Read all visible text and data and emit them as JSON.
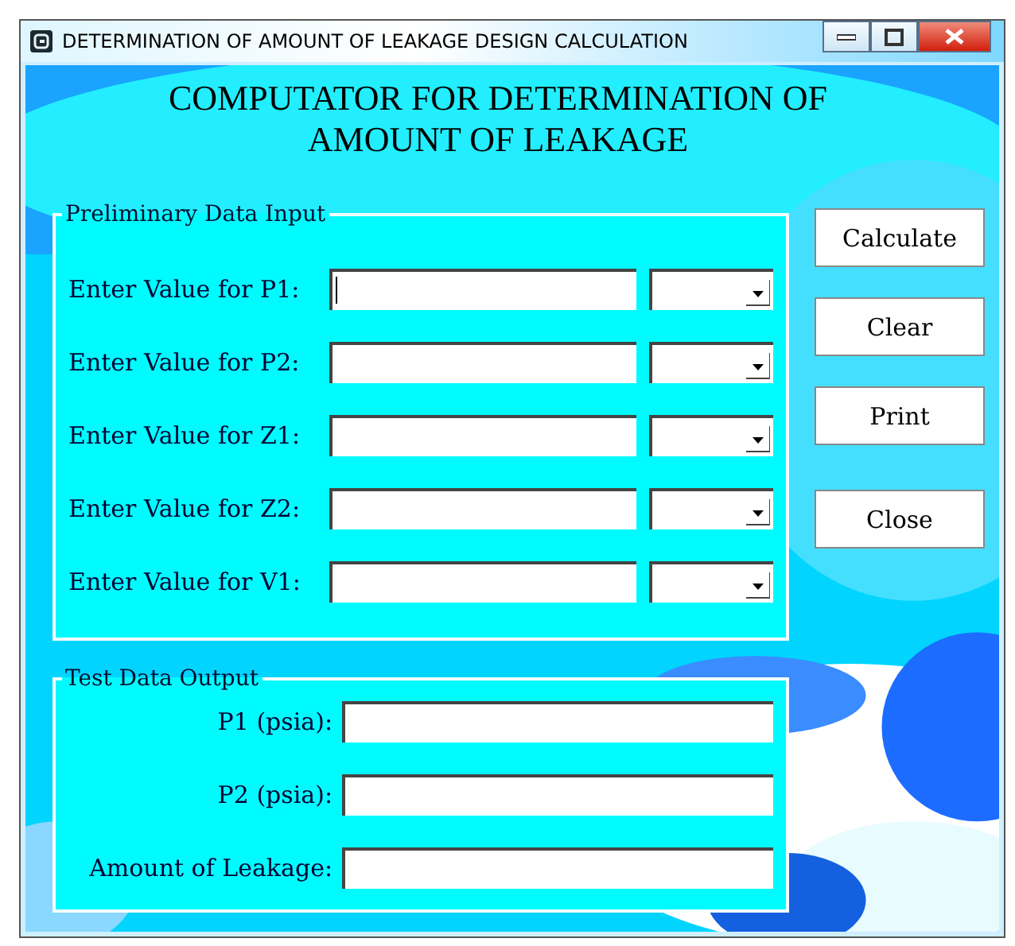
{
  "window": {
    "title": "DETERMINATION OF AMOUNT OF LEAKAGE DESIGN CALCULATION"
  },
  "heading": [
    "COMPUTATOR FOR DETERMINATION OF",
    "AMOUNT OF LEAKAGE"
  ],
  "input_group": {
    "title": "Preliminary Data Input",
    "rows": [
      {
        "label": "Enter Value for P1:",
        "focused": true
      },
      {
        "label": "Enter Value for P2:",
        "focused": false
      },
      {
        "label": "Enter Value for Z1:",
        "focused": false
      },
      {
        "label": "Enter Value for Z2:",
        "focused": false
      },
      {
        "label": "Enter Value for V1:",
        "focused": false
      }
    ]
  },
  "buttons": [
    "Calculate",
    "Clear",
    "Print",
    "Close"
  ],
  "output_group": {
    "title": "Test Data Output",
    "rows": [
      {
        "label": "P1 (psia):"
      },
      {
        "label": "P2 (psia):"
      },
      {
        "label": "Amount of Leakage:"
      }
    ]
  }
}
